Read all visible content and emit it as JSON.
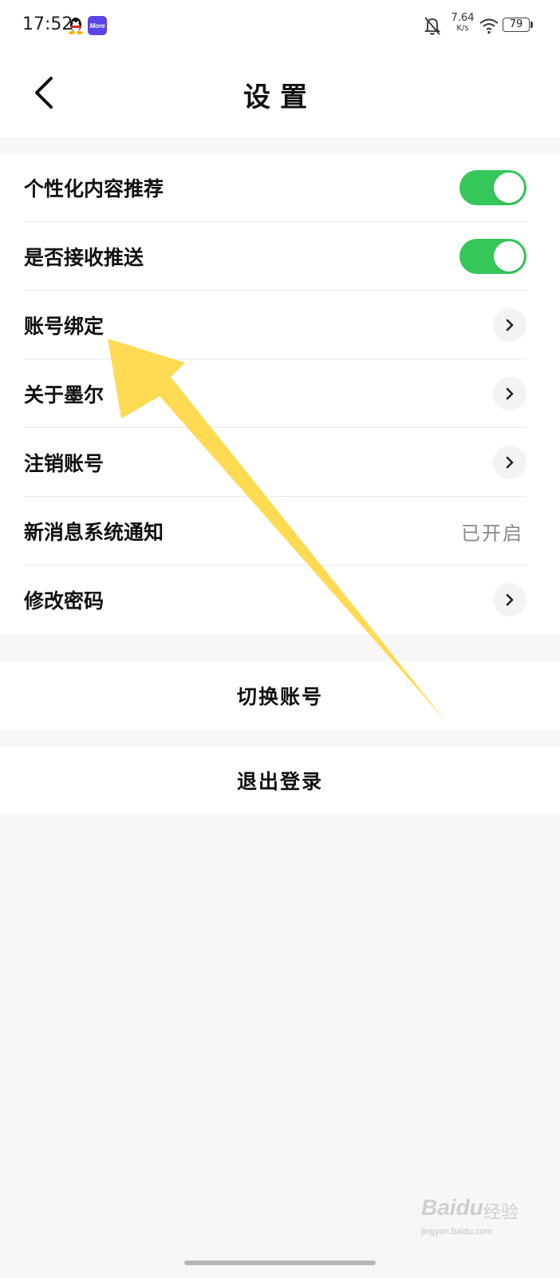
{
  "status_bar": {
    "time": "17:52",
    "app_icons": [
      "qq-icon",
      "more-app-icon"
    ],
    "more_app_label": "More",
    "net_speed_value": "7.64",
    "net_speed_unit": "K/s",
    "battery": "79"
  },
  "header": {
    "title": "设置",
    "back_icon": "chevron-left-icon"
  },
  "settings": {
    "rows": [
      {
        "label": "个性化内容推荐",
        "control": "toggle",
        "on": true
      },
      {
        "label": "是否接收推送",
        "control": "toggle",
        "on": true
      },
      {
        "label": "账号绑定",
        "control": "chevron"
      },
      {
        "label": "关于墨尔",
        "control": "chevron"
      },
      {
        "label": "注销账号",
        "control": "chevron"
      },
      {
        "label": "新消息系统通知",
        "control": "value",
        "value": "已开启"
      },
      {
        "label": "修改密码",
        "control": "chevron"
      }
    ]
  },
  "actions": {
    "switch_account": "切换账号",
    "logout": "退出登录"
  },
  "watermark": {
    "brand": "Baidu",
    "brand_cn": "经验",
    "url": "jingyan.baidu.com"
  },
  "colors": {
    "toggle_on": "#35c75a",
    "annotation_arrow": "#ffd84a",
    "page_background": "#f7f7f7"
  }
}
